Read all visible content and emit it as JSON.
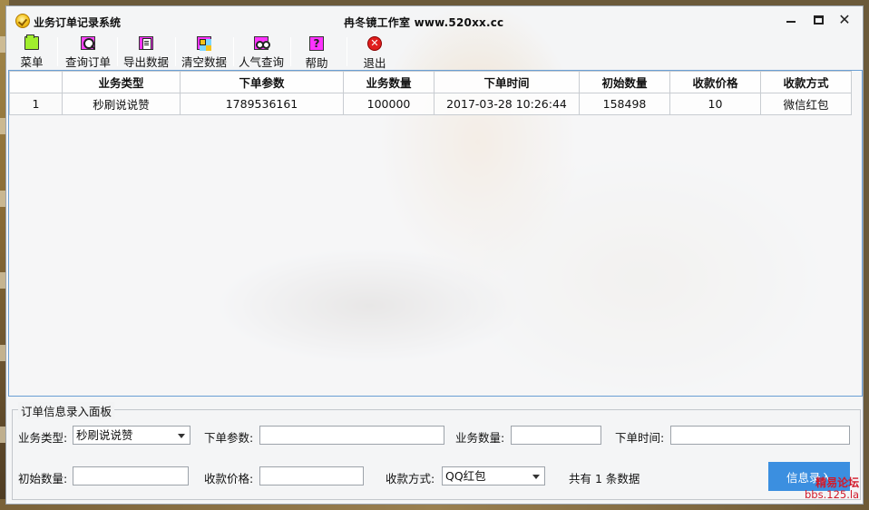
{
  "window": {
    "app_title": "业务订单记录系统",
    "studio_title": "冉冬镜工作室  www.520xx.cc"
  },
  "toolbar": {
    "items": [
      {
        "label": "菜单",
        "icon": "folder-icon"
      },
      {
        "label": "查询订单",
        "icon": "search-icon"
      },
      {
        "label": "导出数据",
        "icon": "export-icon"
      },
      {
        "label": "清空数据",
        "icon": "clear-icon"
      },
      {
        "label": "人气查询",
        "icon": "popularity-icon"
      },
      {
        "label": "帮助",
        "icon": "help-icon"
      },
      {
        "label": "退出",
        "icon": "exit-icon"
      }
    ]
  },
  "grid": {
    "columns": [
      "",
      "业务类型",
      "下单参数",
      "业务数量",
      "下单时间",
      "初始数量",
      "收款价格",
      "收款方式"
    ],
    "rows": [
      [
        "1",
        "秒刷说说赞",
        "1789536161",
        "100000",
        "2017-03-28 10:26:44",
        "158498",
        "10",
        "微信红包"
      ]
    ]
  },
  "form": {
    "panel_title": "订单信息录入面板",
    "business_type_label": "业务类型:",
    "business_type_value": "秒刷说说赞",
    "order_param_label": "下单参数:",
    "order_param_value": "",
    "business_qty_label": "业务数量:",
    "business_qty_value": "",
    "order_time_label": "下单时间:",
    "order_time_value": "",
    "initial_qty_label": "初始数量:",
    "initial_qty_value": "",
    "price_label": "收款价格:",
    "price_value": "",
    "payment_label": "收款方式:",
    "payment_value": "QQ红包",
    "count_text": "共有 1 条数据",
    "submit_label": "信息录入"
  },
  "watermark": {
    "line1": "精易论坛",
    "line2": "bbs.125.la"
  },
  "colors": {
    "accent": "#3b8fe0",
    "grid_border": "#6a9fd4",
    "watermark": "#d21a2a"
  }
}
